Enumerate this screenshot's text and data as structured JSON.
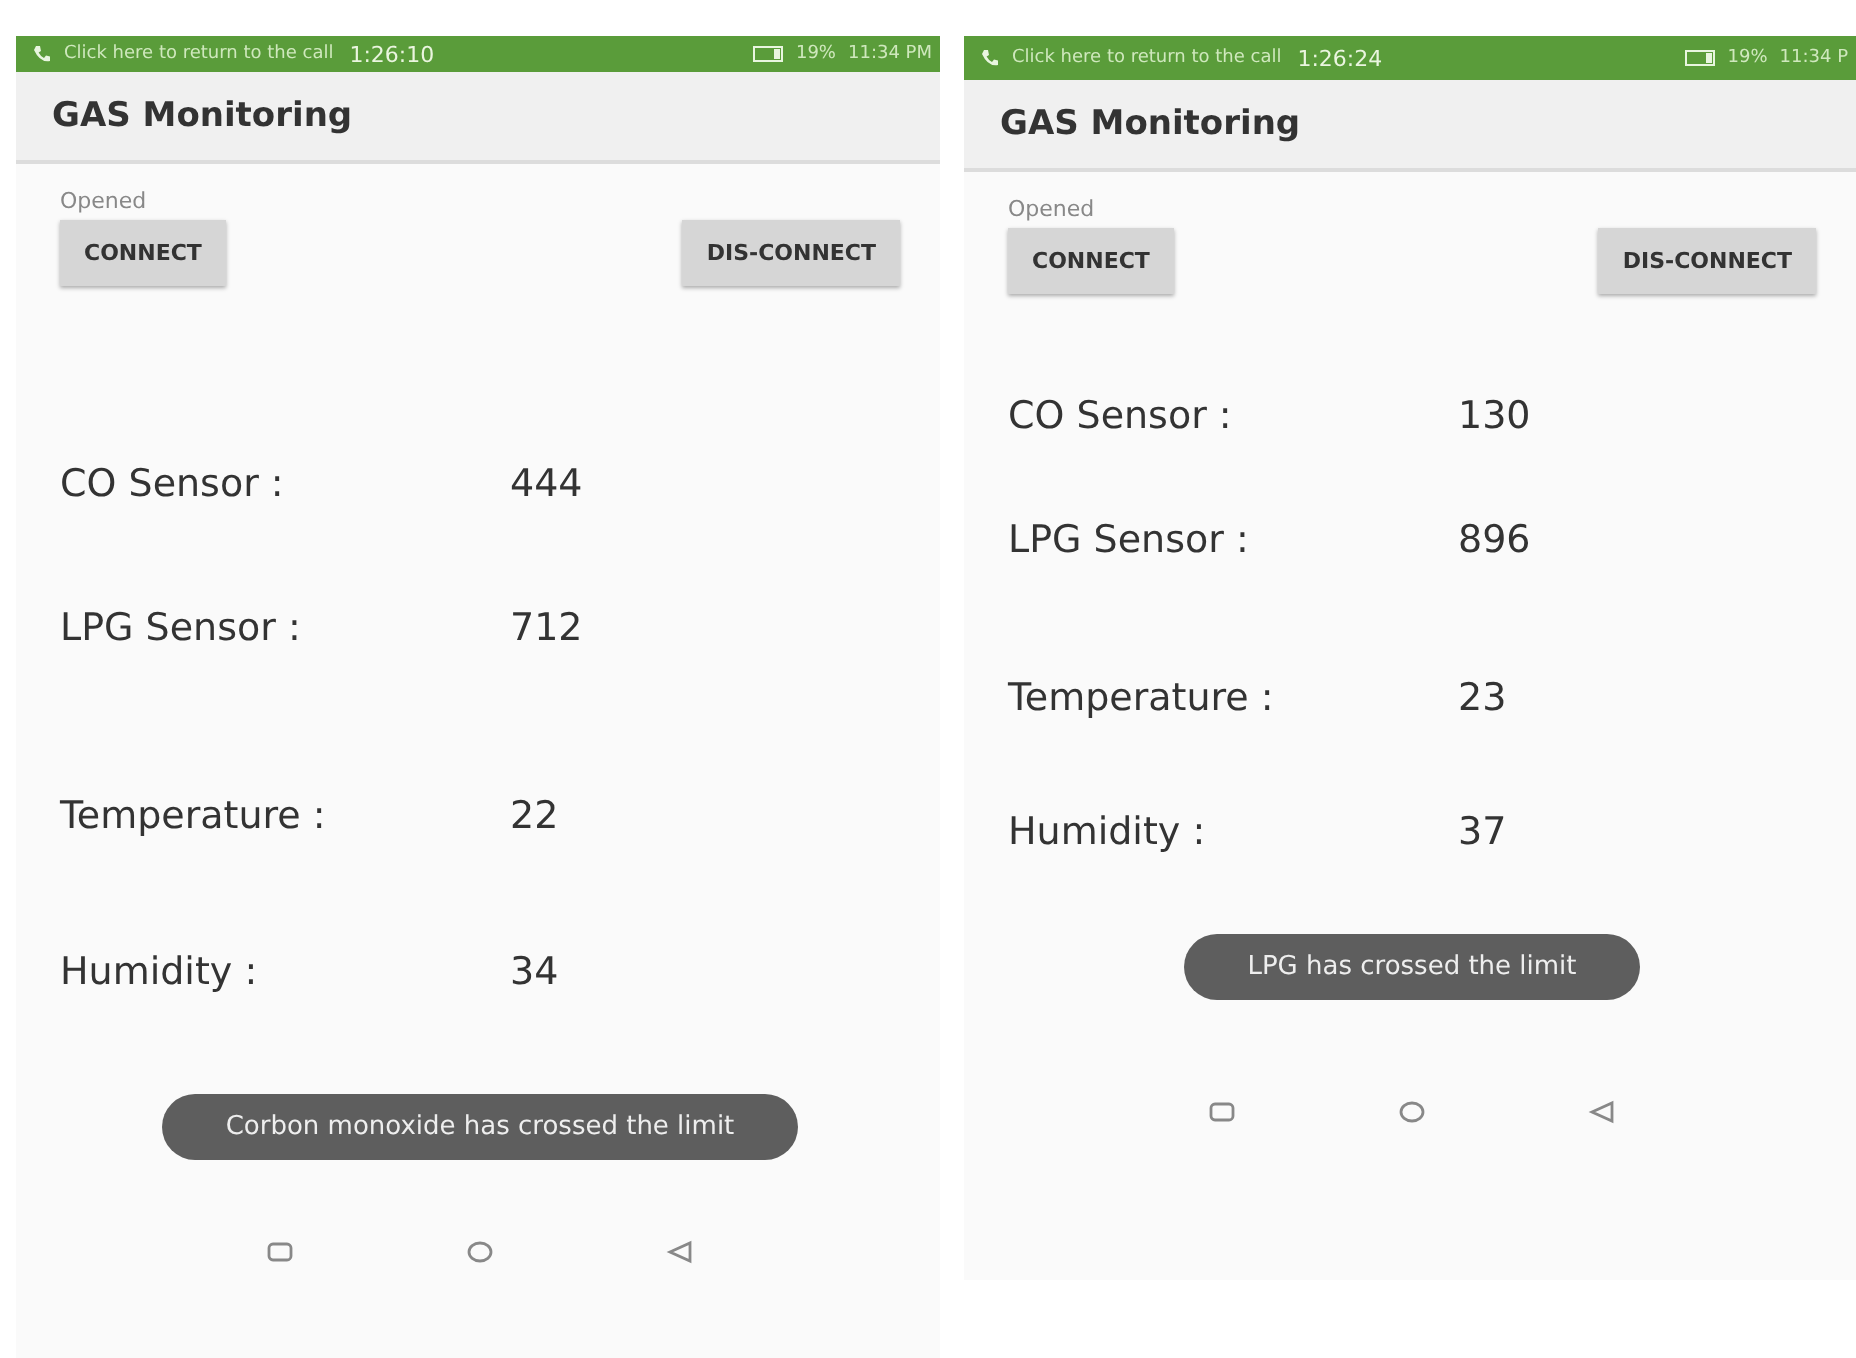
{
  "screens": [
    {
      "status_bar": {
        "call_text": "Click here to return to the call",
        "call_timer": "1:26:10",
        "battery": "19%",
        "time": "11:34 PM"
      },
      "app_bar": {
        "title": "GAS Monitoring"
      },
      "connection_status": "Opened",
      "buttons": [
        "CONNECT",
        "DIS-CONNECT"
      ],
      "readings": [
        {
          "label": "CO Sensor :",
          "value": "444"
        },
        {
          "label": "LPG Sensor :",
          "value": "712"
        },
        {
          "label": "Temperature :",
          "value": "22"
        },
        {
          "label": "Humidity :",
          "value": "34"
        }
      ],
      "toast": "Corbon monoxide has crossed the limit"
    },
    {
      "status_bar": {
        "call_text": "Click here to return to the call",
        "call_timer": "1:26:24",
        "battery": "19%",
        "time": "11:34 P"
      },
      "app_bar": {
        "title": "GAS Monitoring"
      },
      "connection_status": "Opened",
      "buttons": [
        "CONNECT",
        "DIS-CONNECT"
      ],
      "readings": [
        {
          "label": "CO Sensor :",
          "value": "130"
        },
        {
          "label": "LPG Sensor :",
          "value": "896"
        },
        {
          "label": "Temperature :",
          "value": "23"
        },
        {
          "label": "Humidity :",
          "value": "37"
        }
      ],
      "toast": "LPG has crossed the limit"
    }
  ]
}
